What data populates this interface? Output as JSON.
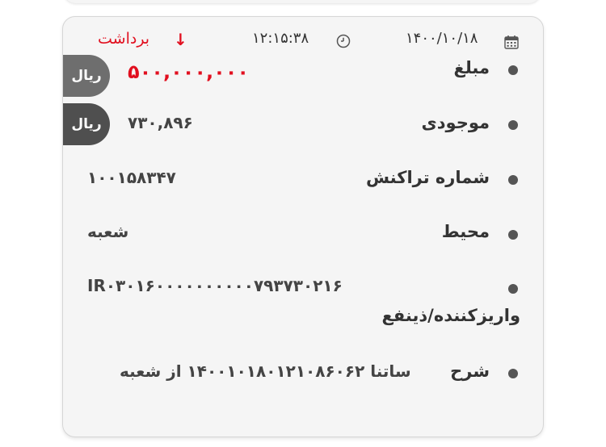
{
  "header": {
    "date": "۱۴۰۰/۱۰/۱۸",
    "time": "۱۲:۱۵:۳۸",
    "transaction_type": "برداشت",
    "type_arrow": "↓"
  },
  "amount": {
    "label": "مبلغ",
    "value": "۵۰۰,۰۰۰,۰۰۰",
    "currency": "ریال"
  },
  "balance": {
    "label": "موجودی",
    "value": "۷۳۰,۸۹۶",
    "currency": "ریال"
  },
  "transaction_number": {
    "label": "شماره تراکنش",
    "value": "۱۰۰۱۵۸۳۴۷"
  },
  "channel": {
    "label": "محیط",
    "value": "شعبه"
  },
  "depositor": {
    "label": "واریزکننده/ذینفع",
    "value": "IR۰۳۰۱۶۰۰۰۰۰۰۰۰۰۰۷۹۳۷۳۰۲۱۶"
  },
  "description": {
    "label": "شرح",
    "value": "ساتنا ۱۴۰۰۱۰۱۸۰۱۲۱۰۸۶۰۶۲ از شعبه"
  },
  "colors": {
    "accent_red": "#e10f1f",
    "badge_gray_light": "#6e6e6e",
    "badge_gray_dark": "#4f4f4f",
    "card_background": "#f5f5f5"
  },
  "icons": {
    "date": "calendar-icon",
    "time": "clock-icon"
  }
}
